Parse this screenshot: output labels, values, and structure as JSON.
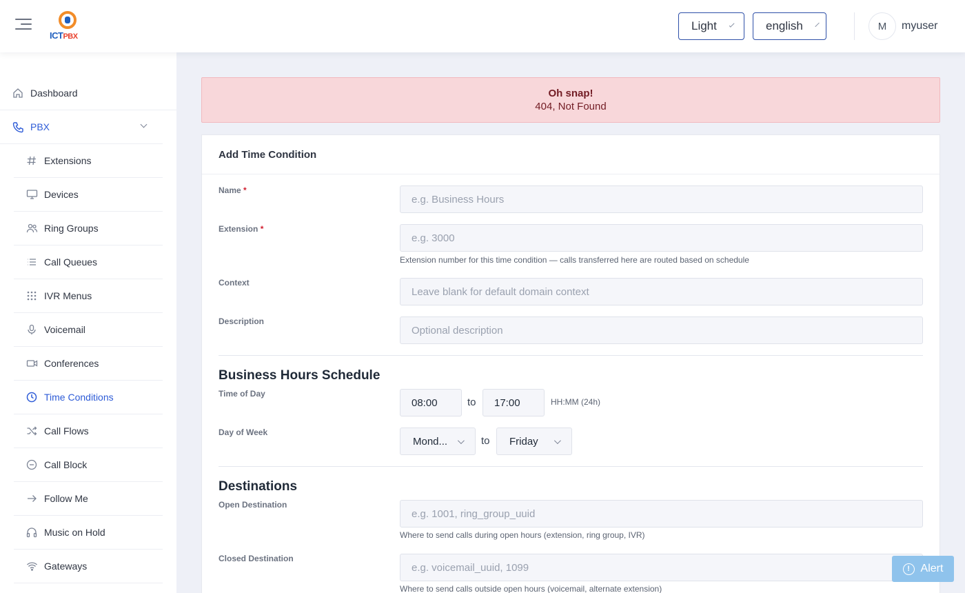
{
  "header": {
    "theme": "Light",
    "language": "english",
    "avatar_initial": "M",
    "username": "myuser",
    "logo_text_a": "ICT",
    "logo_text_b": "PBX"
  },
  "sidebar": {
    "dashboard": "Dashboard",
    "pbx": "PBX",
    "items": [
      {
        "label": "Extensions",
        "icon": "hash-icon"
      },
      {
        "label": "Devices",
        "icon": "monitor-icon"
      },
      {
        "label": "Ring Groups",
        "icon": "users-icon"
      },
      {
        "label": "Call Queues",
        "icon": "list-icon"
      },
      {
        "label": "IVR Menus",
        "icon": "grid-icon"
      },
      {
        "label": "Voicemail",
        "icon": "microphone-icon"
      },
      {
        "label": "Conferences",
        "icon": "video-icon"
      },
      {
        "label": "Time Conditions",
        "icon": "clock-icon",
        "active": true
      },
      {
        "label": "Call Flows",
        "icon": "shuffle-icon"
      },
      {
        "label": "Call Block",
        "icon": "minus-circle-icon"
      },
      {
        "label": "Follow Me",
        "icon": "arrow-right-icon"
      },
      {
        "label": "Music on Hold",
        "icon": "headphones-icon"
      },
      {
        "label": "Gateways",
        "icon": "wifi-icon"
      }
    ]
  },
  "alert": {
    "title": "Oh snap!",
    "message": "404, Not Found"
  },
  "form": {
    "title": "Add Time Condition",
    "name_label": "Name",
    "name_placeholder": "e.g. Business Hours",
    "extension_label": "Extension",
    "extension_placeholder": "e.g. 3000",
    "extension_help": "Extension number for this time condition — calls transferred here are routed based on schedule",
    "context_label": "Context",
    "context_placeholder": "Leave blank for default domain context",
    "description_label": "Description",
    "description_placeholder": "Optional description",
    "required_mark": "*",
    "schedule": {
      "title": "Business Hours Schedule",
      "time_label": "Time of Day",
      "time_start": "08:00",
      "time_end": "17:00",
      "to": "to",
      "time_hint": "HH:MM (24h)",
      "day_label": "Day of Week",
      "day_start": "Mond...",
      "day_end": "Friday"
    },
    "destinations": {
      "title": "Destinations",
      "open_label": "Open Destination",
      "open_placeholder": "e.g. 1001, ring_group_uuid",
      "open_help": "Where to send calls during open hours (extension, ring group, IVR)",
      "closed_label": "Closed Destination",
      "closed_placeholder": "e.g. voicemail_uuid, 1099",
      "closed_help": "Where to send calls outside open hours (voicemail, alternate extension)"
    }
  },
  "alert_button": {
    "icon_glyph": "!",
    "label": "Alert"
  }
}
